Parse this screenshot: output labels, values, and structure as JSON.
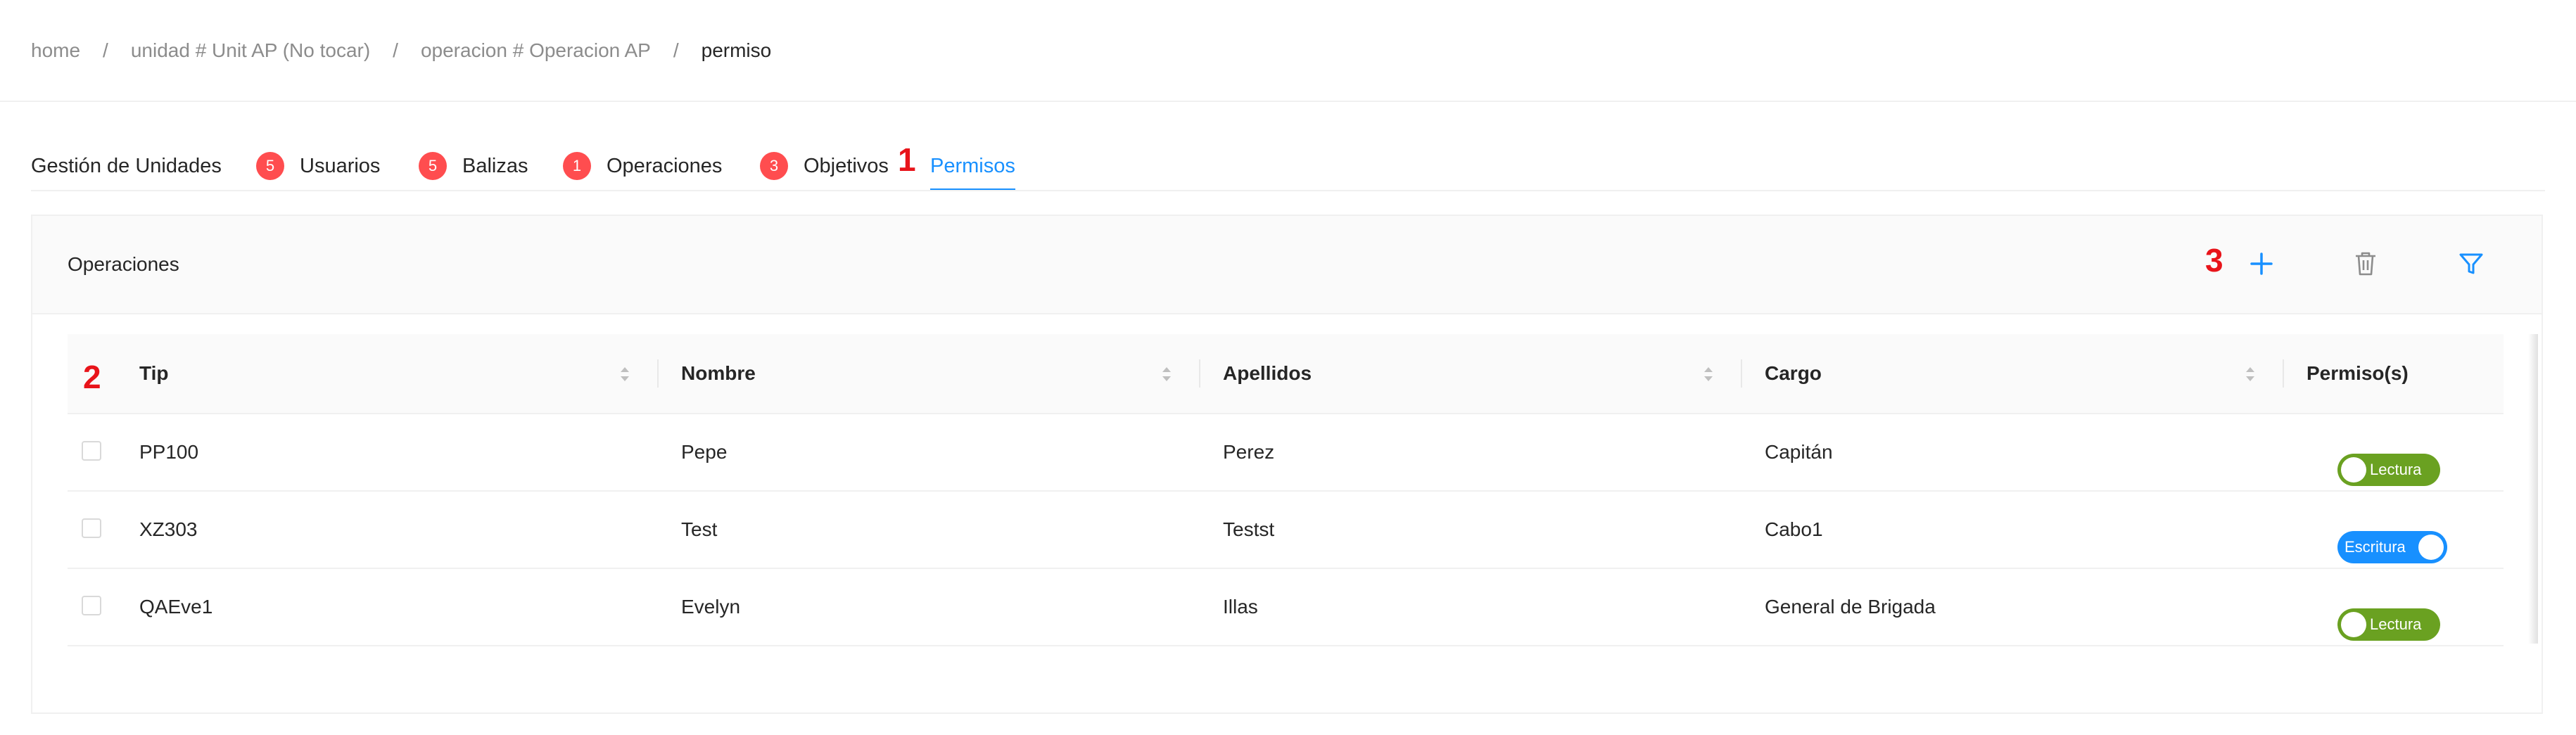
{
  "breadcrumb": [
    {
      "label": "home"
    },
    {
      "label": "unidad # Unit AP (No tocar)"
    },
    {
      "label": "operacion # Operacion AP"
    },
    {
      "label": "permiso"
    }
  ],
  "breadcrumb_separator": "/",
  "tabs": [
    {
      "label": "Gestión de Unidades",
      "badge": ""
    },
    {
      "label": "Usuarios",
      "badge": "5"
    },
    {
      "label": "Balizas",
      "badge": "5"
    },
    {
      "label": "Operaciones",
      "badge": "1"
    },
    {
      "label": "Objetivos",
      "badge": "3"
    },
    {
      "label": "Permisos",
      "badge": "",
      "active": true
    }
  ],
  "annotations": {
    "tab": "1",
    "table": "2",
    "add": "3"
  },
  "card": {
    "title": "Operaciones",
    "icons": [
      "plus-icon",
      "trash-icon",
      "filter-icon"
    ]
  },
  "table": {
    "columns": [
      "Tip",
      "Nombre",
      "Apellidos",
      "Cargo",
      "Permiso(s)"
    ],
    "rows": [
      {
        "tip": "PP100",
        "nombre": "Pepe",
        "apellidos": "Perez",
        "cargo": "Capitán",
        "permiso": "Lectura"
      },
      {
        "tip": "XZ303",
        "nombre": "Test",
        "apellidos": "Testst",
        "cargo": "Cabo1",
        "permiso": "Escritura"
      },
      {
        "tip": "QAEve1",
        "nombre": "Evelyn",
        "apellidos": "Illas",
        "cargo": "General de Brigada",
        "permiso": "Lectura"
      }
    ]
  },
  "colors": {
    "accent": "#1890ff",
    "badge": "#ff4d4f",
    "lectura": "#6aa121",
    "annotation": "#e8141a"
  }
}
